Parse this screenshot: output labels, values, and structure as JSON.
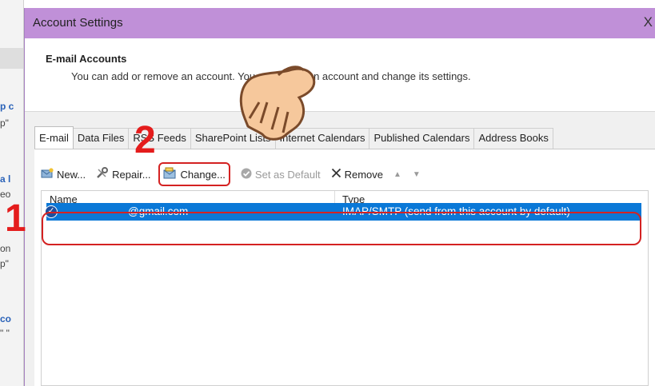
{
  "dialog": {
    "title": "Account Settings",
    "close_glyph": "X"
  },
  "header": {
    "title": "E-mail Accounts",
    "description": "You can add or remove an account. You can select an account and change its settings."
  },
  "tabs": [
    {
      "label": "E-mail",
      "active": true
    },
    {
      "label": "Data Files"
    },
    {
      "label": "RSS Feeds"
    },
    {
      "label": "SharePoint Lists"
    },
    {
      "label": "Internet Calendars"
    },
    {
      "label": "Published Calendars"
    },
    {
      "label": "Address Books"
    }
  ],
  "toolbar": {
    "new": "New...",
    "repair": "Repair...",
    "change": "Change...",
    "set_default": "Set as Default",
    "remove": "Remove"
  },
  "list": {
    "headers": {
      "name": "Name",
      "type": "Type"
    },
    "rows": [
      {
        "name": "@gmail.com",
        "type": "IMAP/SMTP (send from this account by default)",
        "selected": true
      }
    ]
  },
  "annotations": {
    "step1": "1",
    "step2": "2"
  },
  "background_fragments": [
    "p c",
    "p\"",
    "a l",
    "eo",
    "on",
    "p\"",
    "co",
    "\" \""
  ],
  "colors": {
    "title_bar": "#c090d8",
    "selection": "#0a78d7",
    "annotation": "#d42222"
  }
}
